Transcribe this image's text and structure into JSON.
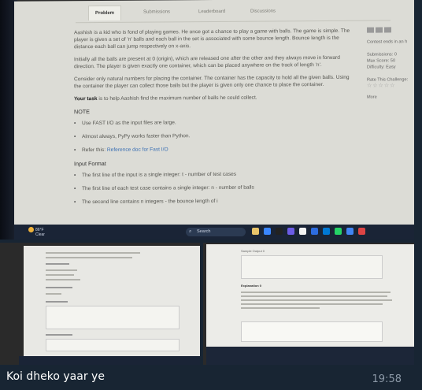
{
  "problem": {
    "tabs": [
      "Problem",
      "Submissions",
      "Leaderboard",
      "Discussions"
    ],
    "intro": "Aashish is a kid who is fond of playing games. He once got a chance to play a game with balls. The game is simple. The player is given a set of 'n' balls and each ball in the set is associated with some bounce length. Bounce length is the distance each ball can jump respectively on x-axis.",
    "para2": "Initially all the balls are present at 0 (origin), which are released one after the other and they always move in forward direction. The player is given exactly one container, which can be placed anywhere on the track of length 'n'.",
    "para3": "Consider only natural numbers for placing the container. The container has the capacity to hold all the given balls. Using the container the player can collect those balls but the player is given only one chance to place the container.",
    "task_label": "Your task",
    "task_text": " is to help Aashish find the maximum number of balls he could collect.",
    "note_heading": "NOTE",
    "notes": [
      "Use FAST I/O as the input files are large.",
      "Almost always, PyPy works faster than Python."
    ],
    "refer_prefix": "Refer this: ",
    "refer_link": "Reference doc for Fast I/O",
    "input_heading": "Input Format",
    "input_items": [
      "The first line of the input is a single integer: t - number of test cases",
      "The first line of each test case contains a single integer: n - number of balls",
      "The second line contains n integers - the bounce length of i"
    ]
  },
  "sidebar": {
    "contest": "Contest ends in an h",
    "submissions": "Submissions: 0",
    "max_score": "Max Score: 50",
    "difficulty": "Difficulty: Easy",
    "rate": "Rate This Challenge:",
    "stars": "☆☆☆☆☆",
    "more": "More"
  },
  "taskbar": {
    "temp": "86°F",
    "weather": "Clear",
    "search": "Search"
  },
  "right_photo": {
    "sample_output": "Sample Output 0",
    "explanation": "Explanation 0"
  },
  "message": {
    "caption": "Koi dheko yaar ye",
    "time": "19:58"
  }
}
